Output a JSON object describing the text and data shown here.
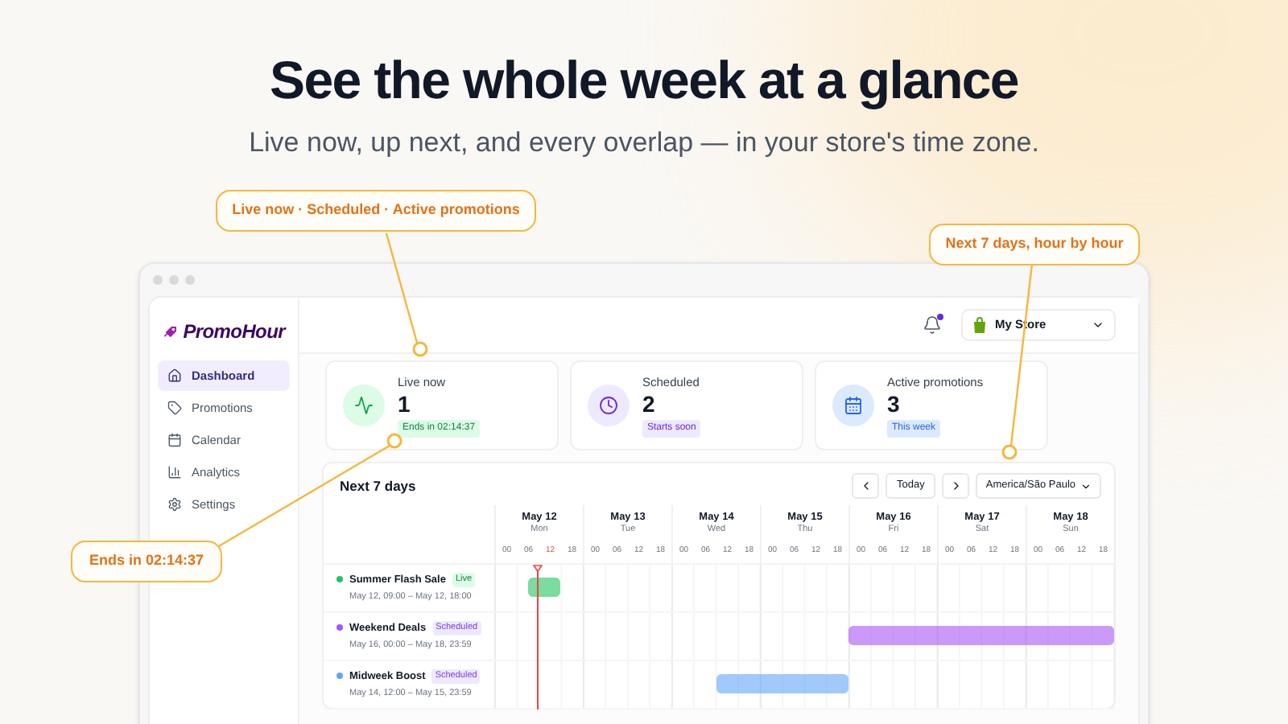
{
  "headline": "See the whole week at a glance",
  "subhead": "Live now, up next, and every overlap — in your store's time zone.",
  "callouts": [
    {
      "text": "Live now · Scheduled · Active promotions",
      "kind": "top"
    },
    {
      "text": "Next 7 days, hour by hour",
      "kind": "right"
    },
    {
      "text": "Ends in 02:14:37",
      "kind": "left"
    }
  ],
  "app": {
    "logo": "PromoHour",
    "sidebar": [
      {
        "label": "Dashboard",
        "selected": true
      },
      {
        "label": "Promotions",
        "selected": false
      },
      {
        "label": "Calendar",
        "selected": false
      },
      {
        "label": "Analytics",
        "selected": false
      },
      {
        "label": "Settings",
        "selected": false
      }
    ],
    "notifications": {
      "unread": true
    },
    "store": "My Store",
    "stats": [
      {
        "label": "Live now",
        "value": "1",
        "badge": "Ends in 02:14:37",
        "kind": "live"
      },
      {
        "label": "Scheduled",
        "value": "2",
        "badge": "Starts soon",
        "kind": "scheduled"
      },
      {
        "label": "Active promotions",
        "value": "3",
        "badge": "This week",
        "kind": "active"
      }
    ],
    "schedule": {
      "title": "Next 7 days",
      "today": "Today",
      "timezone": "America/São Paulo",
      "days": [
        {
          "date": "May 12",
          "weekday": "Mon",
          "hours": [
            {
              "label": "00",
              "current": false
            },
            {
              "label": "06",
              "current": false
            },
            {
              "label": "12",
              "current": true
            },
            {
              "label": "18",
              "current": false
            }
          ]
        },
        {
          "date": "May 13",
          "weekday": "Tue",
          "hours": [
            {
              "label": "00",
              "current": false
            },
            {
              "label": "06",
              "current": false
            },
            {
              "label": "12",
              "current": false
            },
            {
              "label": "18",
              "current": false
            }
          ]
        },
        {
          "date": "May 14",
          "weekday": "Wed",
          "hours": [
            {
              "label": "00",
              "current": false
            },
            {
              "label": "06",
              "current": false
            },
            {
              "label": "12",
              "current": false
            },
            {
              "label": "18",
              "current": false
            }
          ]
        },
        {
          "date": "May 15",
          "weekday": "Thu",
          "hours": [
            {
              "label": "00",
              "current": false
            },
            {
              "label": "06",
              "current": false
            },
            {
              "label": "12",
              "current": false
            },
            {
              "label": "18",
              "current": false
            }
          ]
        },
        {
          "date": "May 16",
          "weekday": "Fri",
          "hours": [
            {
              "label": "00",
              "current": false
            },
            {
              "label": "06",
              "current": false
            },
            {
              "label": "12",
              "current": false
            },
            {
              "label": "18",
              "current": false
            }
          ]
        },
        {
          "date": "May 17",
          "weekday": "Sat",
          "hours": [
            {
              "label": "00",
              "current": false
            },
            {
              "label": "06",
              "current": false
            },
            {
              "label": "12",
              "current": false
            },
            {
              "label": "18",
              "current": false
            }
          ]
        },
        {
          "date": "May 18",
          "weekday": "Sun",
          "hours": [
            {
              "label": "00",
              "current": false
            },
            {
              "label": "06",
              "current": false
            },
            {
              "label": "12",
              "current": false
            },
            {
              "label": "18",
              "current": false
            }
          ]
        }
      ],
      "promotions": [
        {
          "name": "Summer Flash Sale",
          "status": "Live",
          "kind": "live",
          "color": "#22c55e",
          "range": "May 12, 09:00 – May 12, 18:00"
        },
        {
          "name": "Weekend Deals",
          "status": "Scheduled",
          "kind": "scheduled",
          "color": "#a855f7",
          "range": "May 16, 00:00 – May 18, 23:59"
        },
        {
          "name": "Midweek Boost",
          "status": "Scheduled",
          "kind": "scheduled",
          "color": "#60a5fa",
          "range": "May 14, 12:00 – May 15, 23:59"
        }
      ]
    }
  }
}
